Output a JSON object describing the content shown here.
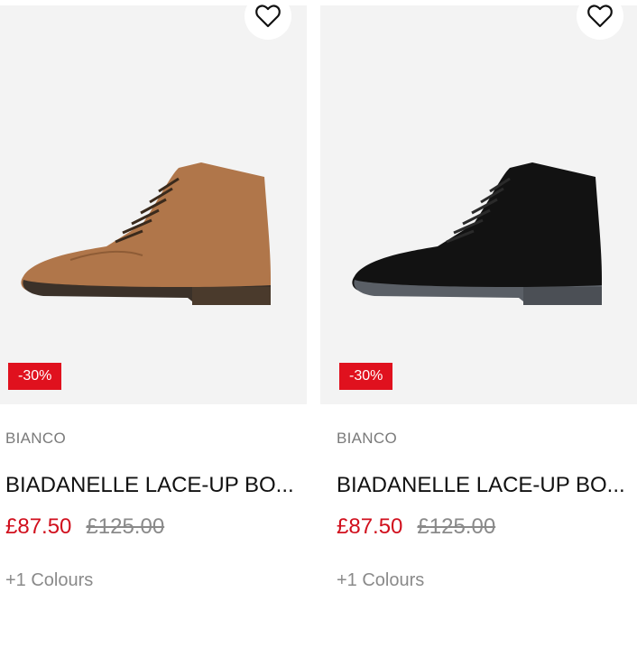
{
  "products": [
    {
      "brand": "BIANCO",
      "name": "BIADANELLE LACE-UP BO...",
      "sale_price": "£87.50",
      "original_price": "£125.00",
      "discount_badge": "-30%",
      "colours": "+1 Colours",
      "boot_color": "#b0764a",
      "wishlist_icon": "heart-outline-icon"
    },
    {
      "brand": "BIANCO",
      "name": "BIADANELLE LACE-UP BO...",
      "sale_price": "£87.50",
      "original_price": "£125.00",
      "discount_badge": "-30%",
      "colours": "+1 Colours",
      "boot_color": "#121212",
      "wishlist_icon": "heart-outline-icon"
    }
  ],
  "colors": {
    "sale": "#d10f1d",
    "badge": "#e0111e",
    "image_bg": "#f3f3f3"
  }
}
